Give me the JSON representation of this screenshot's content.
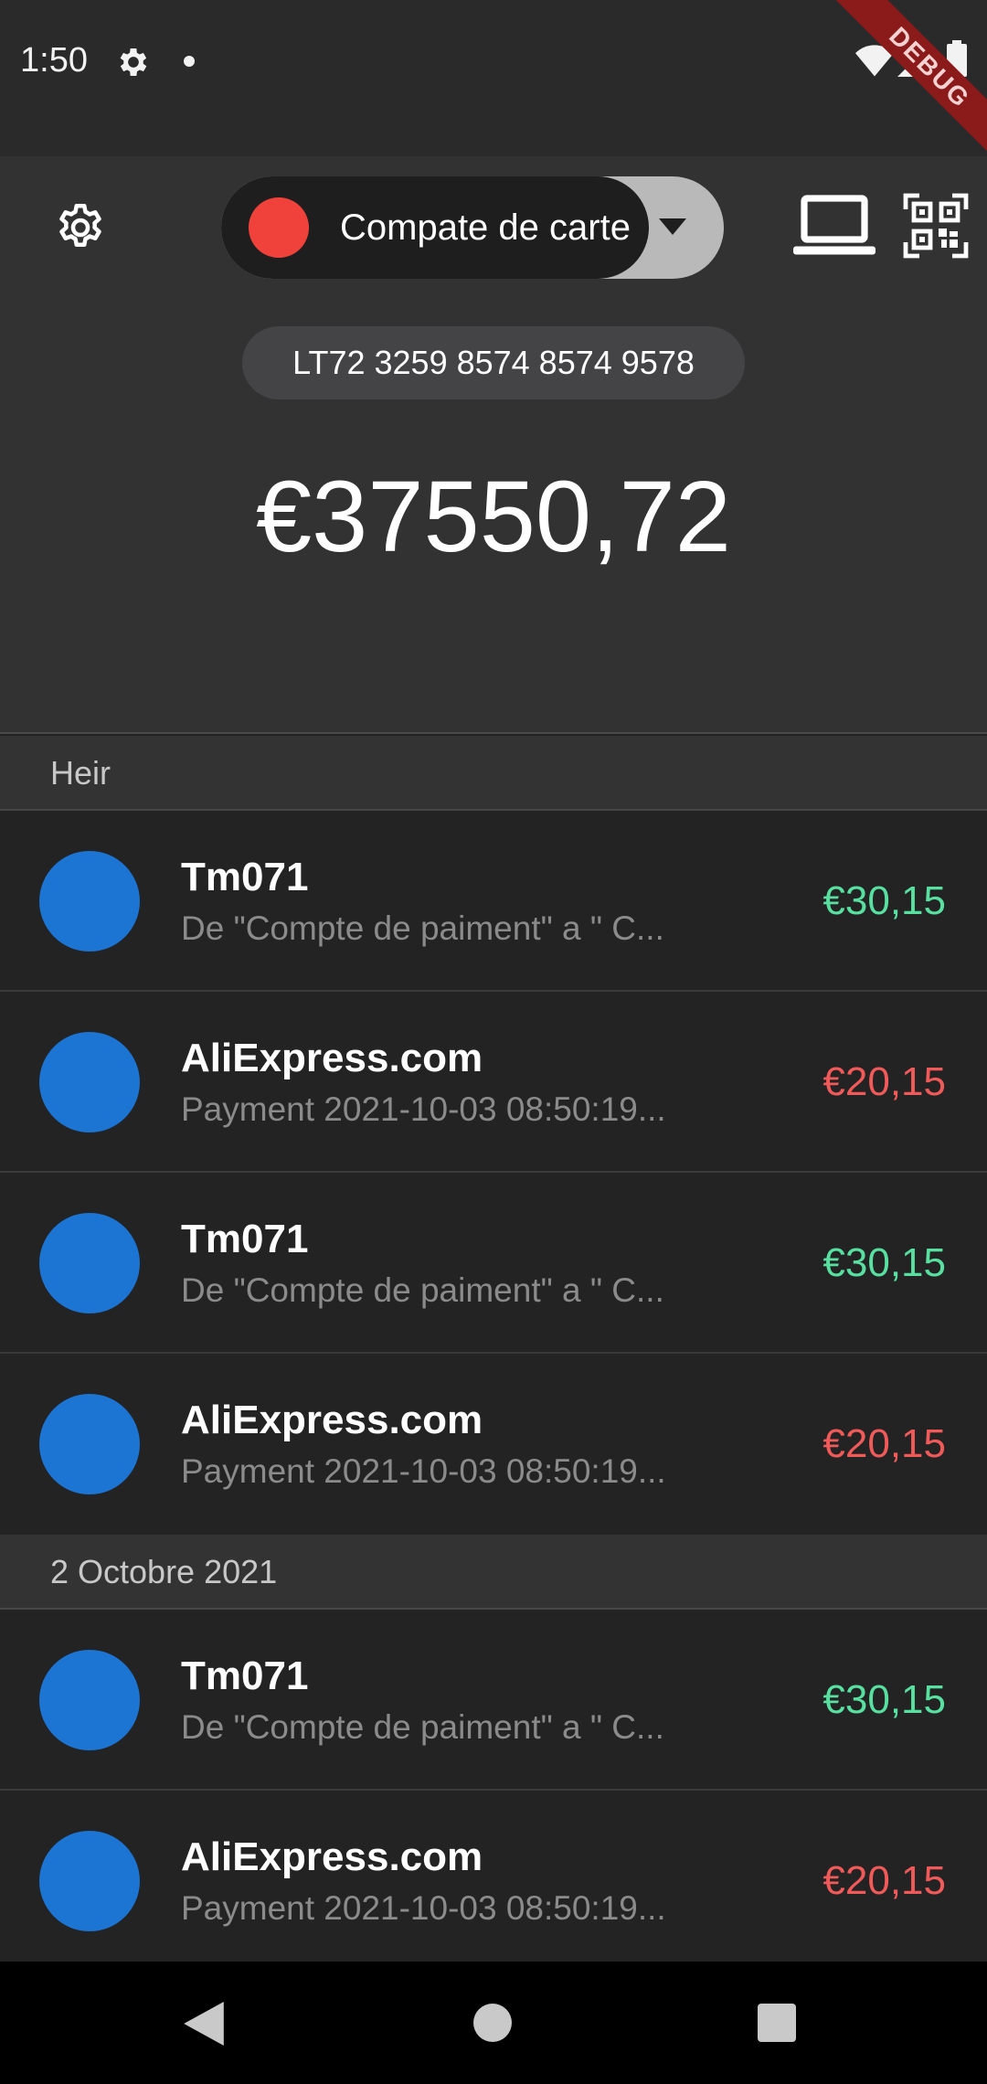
{
  "status_bar": {
    "time": "1:50",
    "debug_label": "DEBUG",
    "icons": [
      "gear-icon",
      "notification-dot-icon",
      "wifi-icon",
      "signal-icon",
      "battery-icon"
    ]
  },
  "header": {
    "account": {
      "name": "Compate de carte",
      "color": "#f0423a"
    },
    "iban": "LT72 3259 8574 8574 9578",
    "balance": "€37550,72",
    "icons": [
      "settings-icon",
      "chevron-down-icon",
      "laptop-icon",
      "qr-code-icon"
    ]
  },
  "sections": [
    {
      "label": "Heir",
      "transactions": [
        {
          "title": "Tm071",
          "subtitle": "De \"Compte de paiment\" a \" C...",
          "amount": "€30,15",
          "direction": "in"
        },
        {
          "title": "AliExpress.com",
          "subtitle": "Payment 2021-10-03 08:50:19...",
          "amount": "€20,15",
          "direction": "out"
        },
        {
          "title": "Tm071",
          "subtitle": "De \"Compte de paiment\" a \" C...",
          "amount": "€30,15",
          "direction": "in"
        },
        {
          "title": "AliExpress.com",
          "subtitle": "Payment 2021-10-03 08:50:19...",
          "amount": "€20,15",
          "direction": "out"
        }
      ]
    },
    {
      "label": "2 Octobre 2021",
      "transactions": [
        {
          "title": "Tm071",
          "subtitle": "De \"Compte de paiment\" a \" C...",
          "amount": "€30,15",
          "direction": "in"
        },
        {
          "title": "AliExpress.com",
          "subtitle": "Payment 2021-10-03 08:50:19...",
          "amount": "€20,15",
          "direction": "out"
        }
      ]
    }
  ],
  "colors": {
    "avatar": "#1c74d3",
    "incoming": "#57e0a0",
    "outgoing": "#f25a5a"
  },
  "nav_bar": {
    "icons": [
      "back-icon",
      "home-icon",
      "recents-icon"
    ]
  }
}
